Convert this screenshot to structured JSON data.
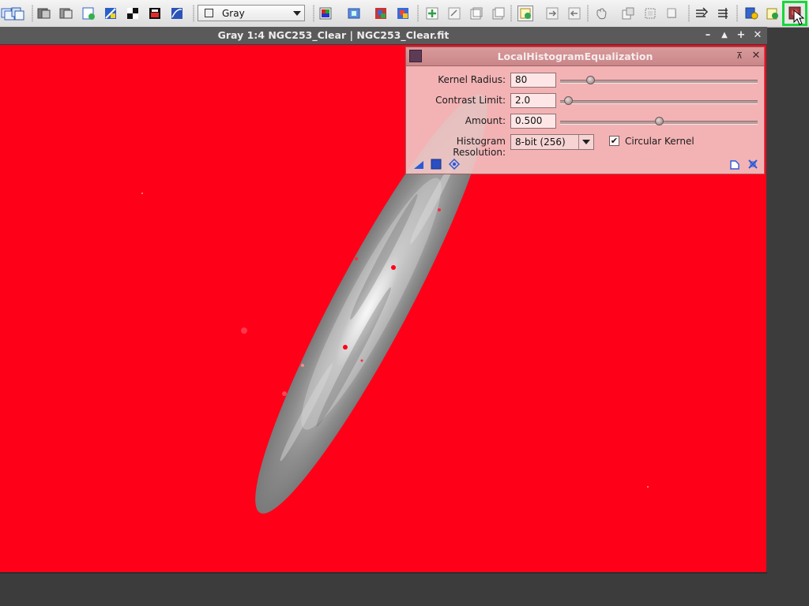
{
  "toolbar": {
    "colorspace": "Gray",
    "icons": [
      "open-icon",
      "copy-icon",
      "duplicate-icon",
      "duplicate-alt-icon",
      "new-image-icon",
      "preview-icon",
      "mask-icon",
      "color-mask-icon",
      "display-function-icon",
      "zoom-icon",
      "rgb-icon",
      "channel-r-icon",
      "channel-g-icon",
      "new-preview-icon",
      "edit-preview-icon",
      "copy-preview-icon",
      "paste-preview-icon",
      "screen-transfer-icon",
      "reset-icon",
      "apply-icon",
      "undo-icon",
      "redo-icon",
      "hand-icon",
      "readout-icon",
      "zoom-in-icon",
      "zoom-out-icon",
      "fit-view-icon",
      "align-icon",
      "explorer-icon",
      "process-icon",
      "script-icon",
      "active-process-icon"
    ],
    "active_tool_color": "#19d63a"
  },
  "image_window": {
    "title": "Gray 1:4 NGC253_Clear | NGC253_Clear.fit",
    "buttons": [
      "–",
      "▲",
      "+",
      "✕"
    ],
    "mask_color": "#ff0019"
  },
  "dialog": {
    "title": "LocalHistogramEqualization",
    "kernel_radius": {
      "label": "Kernel Radius:",
      "value": "80",
      "slider_fraction": 0.15
    },
    "contrast_limit": {
      "label": "Contrast Limit:",
      "value": "2.0",
      "slider_fraction": 0.04
    },
    "amount": {
      "label": "Amount:",
      "value": "0.500",
      "slider_fraction": 0.5
    },
    "histogram_resolution": {
      "label": "Histogram Resolution:",
      "value": "8-bit (256)"
    },
    "circular_kernel": {
      "label": "Circular Kernel",
      "checked": true,
      "check_mark": "✔"
    },
    "footer_icons": [
      "new-instance-icon",
      "apply-global-icon",
      "real-time-preview-icon",
      "browse-documentation-icon",
      "reset-icon"
    ],
    "title_buttons": [
      "⊼",
      "✕"
    ]
  }
}
